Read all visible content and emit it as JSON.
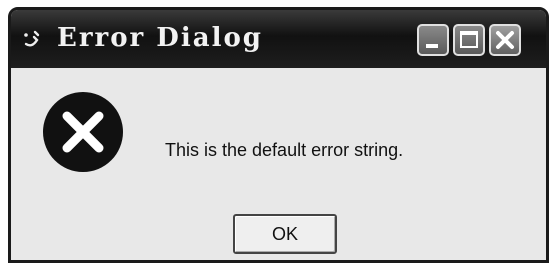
{
  "window": {
    "title": "Error Dialog",
    "controls": {
      "minimize_icon": "minimize-icon",
      "maximize_icon": "maximize-icon",
      "close_icon": "close-icon"
    }
  },
  "dialog": {
    "icon": "error-icon",
    "message": "This is the default error string.",
    "ok_label": "OK"
  },
  "colors": {
    "titlebar": "#111111",
    "body": "#e8e8e8",
    "error_icon_fill": "#111111",
    "error_icon_mark": "#ffffff"
  }
}
